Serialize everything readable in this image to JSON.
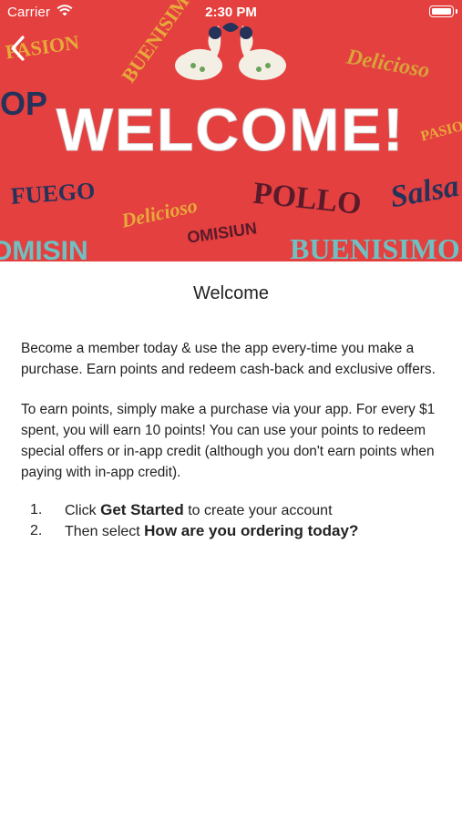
{
  "status_bar": {
    "carrier": "Carrier",
    "time": "2:30 PM",
    "wifi_icon": "wifi-icon",
    "battery_icon": "battery-icon"
  },
  "navigation": {
    "back_icon": "chevron-left-icon"
  },
  "hero": {
    "headline": "WELCOME!",
    "background_color": "#e3403f",
    "decor_words": [
      "PASION",
      "BUENISIMO",
      "Delicioso",
      "POLLO",
      "Salsa",
      "FUEGO",
      "BUENISIMO",
      "Delicioso",
      "PASION"
    ]
  },
  "page": {
    "title": "Welcome",
    "paragraph1": "Become a member today & use the app every-time you make a purchase. Earn points and redeem cash-back and exclusive offers.",
    "paragraph2": "To earn points, simply make a purchase via your app. For every $1 spent, you will earn 10 points! You can use your points to redeem special offers or in-app credit (although you don't earn points when paying with in-app credit).",
    "steps": [
      {
        "number": "1.",
        "prefix": "Click ",
        "bold": "Get Started",
        "suffix": " to create your account"
      },
      {
        "number": "2.",
        "prefix": "Then select ",
        "bold": "How are you ordering today?",
        "suffix": ""
      }
    ]
  }
}
